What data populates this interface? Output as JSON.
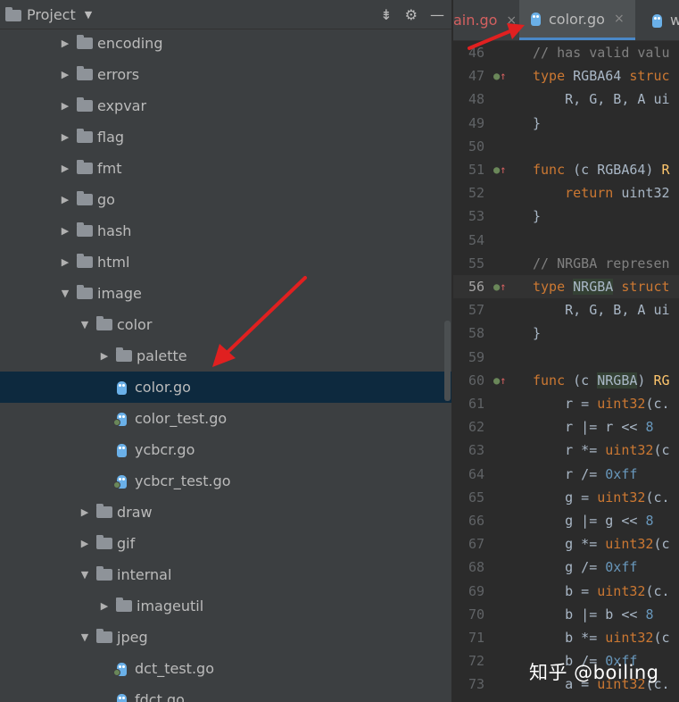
{
  "project": {
    "title": "Project",
    "tree": [
      {
        "label": "encoding",
        "type": "folder",
        "level": 0,
        "expanded": false
      },
      {
        "label": "errors",
        "type": "folder",
        "level": 0,
        "expanded": false
      },
      {
        "label": "expvar",
        "type": "folder",
        "level": 0,
        "expanded": false
      },
      {
        "label": "flag",
        "type": "folder",
        "level": 0,
        "expanded": false
      },
      {
        "label": "fmt",
        "type": "folder",
        "level": 0,
        "expanded": false
      },
      {
        "label": "go",
        "type": "folder",
        "level": 0,
        "expanded": false
      },
      {
        "label": "hash",
        "type": "folder",
        "level": 0,
        "expanded": false
      },
      {
        "label": "html",
        "type": "folder",
        "level": 0,
        "expanded": false
      },
      {
        "label": "image",
        "type": "folder",
        "level": 0,
        "expanded": true
      },
      {
        "label": "color",
        "type": "folder",
        "level": 1,
        "expanded": true
      },
      {
        "label": "palette",
        "type": "folder",
        "level": 2,
        "expanded": false
      },
      {
        "label": "color.go",
        "type": "gofile",
        "level": 2,
        "selected": true
      },
      {
        "label": "color_test.go",
        "type": "gotest",
        "level": 2
      },
      {
        "label": "ycbcr.go",
        "type": "gofile",
        "level": 2
      },
      {
        "label": "ycbcr_test.go",
        "type": "gotest",
        "level": 2
      },
      {
        "label": "draw",
        "type": "folder",
        "level": 1,
        "expanded": false
      },
      {
        "label": "gif",
        "type": "folder",
        "level": 1,
        "expanded": false
      },
      {
        "label": "internal",
        "type": "folder",
        "level": 1,
        "expanded": true
      },
      {
        "label": "imageutil",
        "type": "folder",
        "level": 2,
        "expanded": false
      },
      {
        "label": "jpeg",
        "type": "folder",
        "level": 1,
        "expanded": true
      },
      {
        "label": "dct_test.go",
        "type": "gotest",
        "level": 2
      },
      {
        "label": "fdct.go",
        "type": "gofile",
        "level": 2
      }
    ]
  },
  "tabs": [
    {
      "label": "ain.go",
      "close": "×"
    },
    {
      "label": "color.go",
      "close": "×",
      "active": true
    },
    {
      "label": "wri"
    }
  ],
  "code": [
    {
      "n": "46",
      "html": "<span class='c'>// has valid valu</span>"
    },
    {
      "n": "47",
      "html": "<span class='k'>type</span> <span class='t'>RGBA64</span> <span class='k'>struc</span>",
      "gutter": "O↑"
    },
    {
      "n": "48",
      "html": "    <span class='t'>R, G, B, A ui</span>"
    },
    {
      "n": "49",
      "html": "<span class='t'>}</span>"
    },
    {
      "n": "50",
      "html": ""
    },
    {
      "n": "51",
      "html": "<span class='k'>func</span> <span class='t'>(c RGBA64) </span><span class='f'>R</span>",
      "gutter": "O↑"
    },
    {
      "n": "52",
      "html": "    <span class='k'>return</span> <span class='t'>uint32</span>"
    },
    {
      "n": "53",
      "html": "<span class='t'>}</span>"
    },
    {
      "n": "54",
      "html": ""
    },
    {
      "n": "55",
      "html": "<span class='c'>// NRGBA represen</span>"
    },
    {
      "n": "56",
      "html": "<span class='k'>type</span> <span class='t hl'>NRGBA</span> <span class='k'>struct</span>",
      "gutter": "O↑",
      "current": true
    },
    {
      "n": "57",
      "html": "    <span class='t'>R, G, B, A ui</span>"
    },
    {
      "n": "58",
      "html": "<span class='t'>}</span>"
    },
    {
      "n": "59",
      "html": ""
    },
    {
      "n": "60",
      "html": "<span class='k'>func</span> <span class='t'>(c </span><span class='t hl'>NRGBA</span><span class='t'>) </span><span class='f'>RG</span>",
      "gutter": "O↑"
    },
    {
      "n": "61",
      "html": "    <span class='t'>r = </span><span class='k'>uint32</span><span class='t'>(c.</span>"
    },
    {
      "n": "62",
      "html": "    <span class='t'>r |= r &lt;&lt; </span><span class='n'>8</span>"
    },
    {
      "n": "63",
      "html": "    <span class='t'>r *= </span><span class='k'>uint32</span><span class='t'>(c</span>"
    },
    {
      "n": "64",
      "html": "    <span class='t'>r /= </span><span class='n'>0xff</span>"
    },
    {
      "n": "65",
      "html": "    <span class='t'>g = </span><span class='k'>uint32</span><span class='t'>(c.</span>"
    },
    {
      "n": "66",
      "html": "    <span class='t'>g |= g &lt;&lt; </span><span class='n'>8</span>"
    },
    {
      "n": "67",
      "html": "    <span class='t'>g *= </span><span class='k'>uint32</span><span class='t'>(c</span>"
    },
    {
      "n": "68",
      "html": "    <span class='t'>g /= </span><span class='n'>0xff</span>"
    },
    {
      "n": "69",
      "html": "    <span class='t'>b = </span><span class='k'>uint32</span><span class='t'>(c.</span>"
    },
    {
      "n": "70",
      "html": "    <span class='t'>b |= b &lt;&lt; </span><span class='n'>8</span>"
    },
    {
      "n": "71",
      "html": "    <span class='t'>b *= </span><span class='k'>uint32</span><span class='t'>(c</span>"
    },
    {
      "n": "72",
      "html": "    <span class='t'>b /= </span><span class='n'>0xff</span>"
    },
    {
      "n": "73",
      "html": "    <span class='t'>a = </span><span class='k'>uint32</span><span class='t'>(c.</span>"
    }
  ],
  "watermark": "知乎 @boiling",
  "colors": {
    "selection": "#0d293e",
    "keyword": "#cc7832",
    "comment": "#808080",
    "number": "#6897bb",
    "arrow": "#e02020"
  }
}
